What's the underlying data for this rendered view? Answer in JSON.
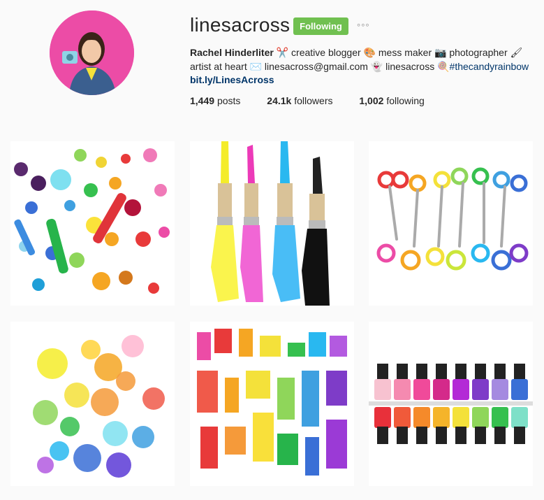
{
  "profile": {
    "username": "linesacross",
    "follow_label": "Following",
    "more_label": "°°°",
    "name": "Rachel Hinderliter",
    "bio_parts": [
      "✂️ creative blogger ",
      "🎨 mess maker ",
      "📷 photographer ",
      "🖌 artist at heart ",
      "✉️ linesacross@gmail.com ",
      "👻 linesacross ",
      "🍭"
    ],
    "hashtag": "#thecandyrainbow",
    "link": "bit.ly/LinesAcross"
  },
  "stats": {
    "posts_count": "1,449",
    "posts_label": "posts",
    "followers_count": "24.1k",
    "followers_label": "followers",
    "following_count": "1,002",
    "following_label": "following"
  },
  "colors": {
    "follow_green": "#70c050",
    "link_blue": "#003569",
    "avatar_pink": "#ec4ca6"
  }
}
